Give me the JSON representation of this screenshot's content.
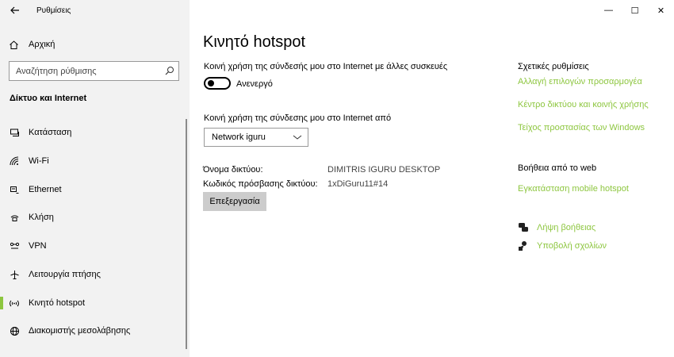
{
  "app": {
    "title": "Ρυθμίσεις",
    "back_icon": "arrow-left-icon",
    "window_controls": {
      "minimize": "—",
      "maximize": "☐",
      "close": "✕"
    }
  },
  "sidebar": {
    "home": {
      "label": "Αρχική",
      "icon": "home-icon"
    },
    "search": {
      "placeholder": "Αναζήτηση ρύθμισης",
      "value": ""
    },
    "section_title": "Δίκτυο και Internet",
    "items": [
      {
        "label": "Κατάσταση",
        "icon": "status-icon",
        "active": false
      },
      {
        "label": "Wi-Fi",
        "icon": "wifi-icon",
        "active": false
      },
      {
        "label": "Ethernet",
        "icon": "ethernet-icon",
        "active": false
      },
      {
        "label": "Κλήση",
        "icon": "dialup-icon",
        "active": false
      },
      {
        "label": "VPN",
        "icon": "vpn-icon",
        "active": false
      },
      {
        "label": "Λειτουργία πτήσης",
        "icon": "airplane-icon",
        "active": false
      },
      {
        "label": "Κινητό hotspot",
        "icon": "hotspot-icon",
        "active": true
      },
      {
        "label": "Διακομιστής μεσολάβησης",
        "icon": "proxy-icon",
        "active": false
      }
    ],
    "accent_color": "#8dc63f"
  },
  "main": {
    "title": "Κινητό hotspot",
    "share_label": "Κοινή χρήση της σύνδεσής μου στο Internet με άλλες συσκευές",
    "toggle_state": "Ανενεργό",
    "share_from_label": "Κοινή χρήση της σύνδεσης μου στο Internet από",
    "share_from_value": "Network iguru",
    "network_name_label": "Όνομα δικτύου:",
    "network_name_value": "DIMITRIS IGURU DESKTOP",
    "password_label": "Κωδικός πρόσβασης δικτύου:",
    "password_value": "1xDiGuru11#14",
    "edit_button": "Επεξεργασία"
  },
  "related": {
    "title": "Σχετικές ρυθμίσεις",
    "links": [
      "Αλλαγή επιλογών προσαρμογέα",
      "Κέντρο δικτύου και κοινής χρήσης",
      "Τείχος προστασίας των Windows"
    ],
    "web_help_title": "Βοήθεια από το web",
    "web_help_link": "Εγκατάσταση mobile hotspot",
    "help_items": [
      {
        "label": "Λήψη βοήθειας",
        "icon": "chat-help-icon"
      },
      {
        "label": "Υποβολή σχολίων",
        "icon": "feedback-icon"
      }
    ],
    "link_color": "#8dc63f"
  }
}
